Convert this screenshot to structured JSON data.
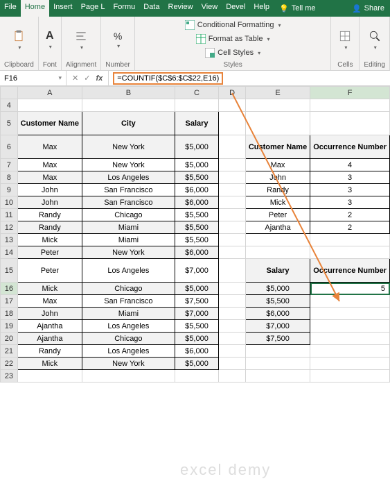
{
  "tabs": {
    "file": "File",
    "home": "Home",
    "insert": "Insert",
    "page": "Page L",
    "formulas": "Formu",
    "data": "Data",
    "review": "Review",
    "view": "View",
    "devel": "Devel",
    "help": "Help",
    "tell": "Tell me",
    "share": "Share"
  },
  "ribbon": {
    "clipboard": "Clipboard",
    "font": "Font",
    "alignment": "Alignment",
    "number": "Number",
    "cond_fmt": "Conditional Formatting",
    "fmt_table": "Format as Table",
    "cell_styles": "Cell Styles",
    "styles": "Styles",
    "cells": "Cells",
    "editing": "Editing"
  },
  "namebox": "F16",
  "formula": "=COUNTIF($C$6:$C$22,E16)",
  "cols": [
    "A",
    "B",
    "C",
    "D",
    "E",
    "F"
  ],
  "rows": [
    "4",
    "5",
    "6",
    "7",
    "8",
    "9",
    "10",
    "11",
    "12",
    "13",
    "14",
    "15",
    "16",
    "17",
    "18",
    "19",
    "20",
    "21",
    "22",
    "23"
  ],
  "main": {
    "h1": "Customer Name",
    "h2": "City",
    "h3": "Salary",
    "r": [
      {
        "n": "Max",
        "c": "New York",
        "s": "$5,000"
      },
      {
        "n": "Max",
        "c": "New York",
        "s": "$5,000"
      },
      {
        "n": "Max",
        "c": "Los Angeles",
        "s": "$5,500"
      },
      {
        "n": "John",
        "c": "San Francisco",
        "s": "$6,000"
      },
      {
        "n": "John",
        "c": "San Francisco",
        "s": "$6,000"
      },
      {
        "n": "Randy",
        "c": "Chicago",
        "s": "$5,500"
      },
      {
        "n": "Randy",
        "c": "Miami",
        "s": "$5,500"
      },
      {
        "n": "Mick",
        "c": "Miami",
        "s": "$5,500"
      },
      {
        "n": "Peter",
        "c": "New York",
        "s": "$6,000"
      },
      {
        "n": "Peter",
        "c": "Los Angeles",
        "s": "$7,000"
      },
      {
        "n": "Mick",
        "c": "Chicago",
        "s": "$5,000"
      },
      {
        "n": "Max",
        "c": "San Francisco",
        "s": "$7,500"
      },
      {
        "n": "John",
        "c": "Miami",
        "s": "$7,000"
      },
      {
        "n": "Ajantha",
        "c": "Los Angeles",
        "s": "$5,500"
      },
      {
        "n": "Ajantha",
        "c": "Chicago",
        "s": "$5,000"
      },
      {
        "n": "Randy",
        "c": "Los Angeles",
        "s": "$6,000"
      },
      {
        "n": "Mick",
        "c": "New York",
        "s": "$5,000"
      }
    ]
  },
  "side1": {
    "h1": "Customer Name",
    "h2": "Occurrence Number",
    "r": [
      {
        "n": "Max",
        "v": "4"
      },
      {
        "n": "John",
        "v": "3"
      },
      {
        "n": "Randy",
        "v": "3"
      },
      {
        "n": "Mick",
        "v": "3"
      },
      {
        "n": "Peter",
        "v": "2"
      },
      {
        "n": "Ajantha",
        "v": "2"
      }
    ]
  },
  "side2": {
    "h1": "Salary",
    "h2": "Occurrence Number",
    "sal": [
      "$5,000",
      "$5,500",
      "$6,000",
      "$7,000",
      "$7,500"
    ],
    "occ": "5"
  },
  "watermark": "excel demy"
}
